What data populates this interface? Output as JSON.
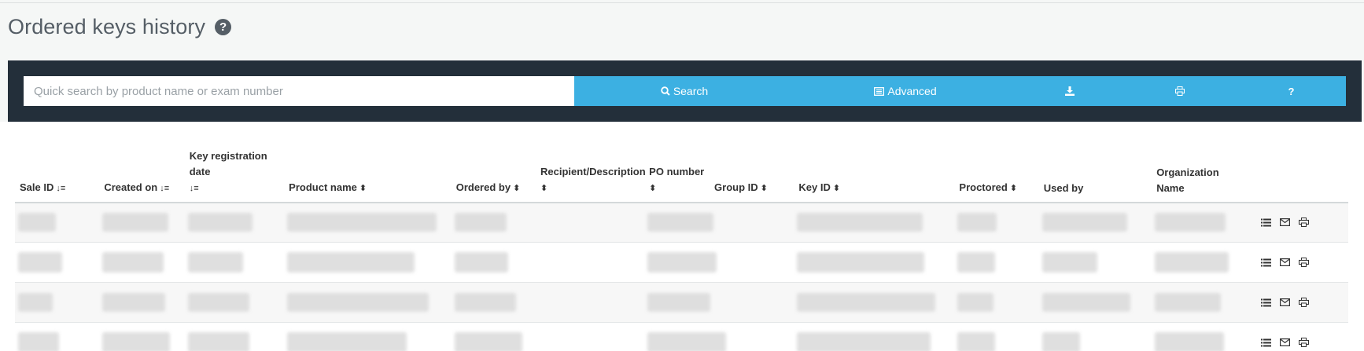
{
  "page": {
    "title": "Ordered keys history",
    "help_icon": "question-circle-icon",
    "help_glyph": "?"
  },
  "search": {
    "placeholder": "Quick search by product name or exam number",
    "value": "",
    "buttons": {
      "search_label": "Search",
      "advanced_label": "Advanced",
      "download_icon": "download-icon",
      "print_icon": "print-icon",
      "help_label": "?"
    }
  },
  "colors": {
    "panel": "#232f3a",
    "button": "#3cb0e2",
    "title": "#555e66"
  },
  "table": {
    "columns": [
      {
        "label": "Sale ID",
        "sort": "sort-amount-down-icon"
      },
      {
        "label": "Created on",
        "sort": "sort-amount-down-icon"
      },
      {
        "label": "Key registration date",
        "sort": "sort-amount-down-icon"
      },
      {
        "label": "Product name",
        "sort": "sort-icon"
      },
      {
        "label": "Ordered by",
        "sort": "sort-icon"
      },
      {
        "label": "Recipient/Description",
        "sort": "sort-icon"
      },
      {
        "label": "PO number",
        "sort": "sort-icon"
      },
      {
        "label": "Group ID",
        "sort": "sort-icon"
      },
      {
        "label": "Key ID",
        "sort": "sort-icon"
      },
      {
        "label": "Proctored",
        "sort": "sort-icon"
      },
      {
        "label": "Used by",
        "sort": ""
      },
      {
        "label": "Organization Name",
        "sort": ""
      },
      {
        "label": "",
        "sort": ""
      }
    ],
    "row_actions": [
      "list-icon",
      "envelope-icon",
      "print-icon"
    ]
  }
}
